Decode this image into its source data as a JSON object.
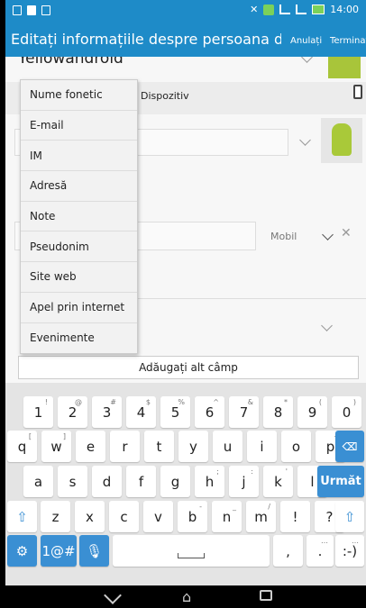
{
  "status_bar": {
    "time": "14:00"
  },
  "action_bar": {
    "title": "Editați informațiile despre persoana din...",
    "cancel_label": "Anulați",
    "done_label": "Terminat"
  },
  "form": {
    "name_value": "Yellowandroid",
    "device_label": "Dispozitiv",
    "phone_type": "Mobil",
    "add_field_label": "Adăugați alt câmp"
  },
  "menu": {
    "items": [
      "Nume fonetic",
      "E-mail",
      "IM",
      "Adresă",
      "Note",
      "Pseudonim",
      "Site web",
      "Apel prin internet",
      "Evenimente"
    ]
  },
  "keyboard": {
    "row1": [
      [
        "1",
        "!"
      ],
      [
        "2",
        "@"
      ],
      [
        "3",
        "#"
      ],
      [
        "4",
        "$"
      ],
      [
        "5",
        "%"
      ],
      [
        "6",
        "^"
      ],
      [
        "7",
        "&"
      ],
      [
        "8",
        "*"
      ],
      [
        "9",
        "("
      ],
      [
        "0",
        ")"
      ]
    ],
    "row2": [
      [
        "q",
        "["
      ],
      [
        "w",
        "]"
      ],
      [
        "e",
        ""
      ],
      [
        "r",
        ""
      ],
      [
        "t",
        ""
      ],
      [
        "y",
        ""
      ],
      [
        "u",
        ""
      ],
      [
        "i",
        ""
      ],
      [
        "o",
        ""
      ],
      [
        "p",
        "+"
      ]
    ],
    "row3": [
      [
        "a",
        ""
      ],
      [
        "s",
        ""
      ],
      [
        "d",
        ""
      ],
      [
        "f",
        ""
      ],
      [
        "g",
        ""
      ],
      [
        "h",
        ";"
      ],
      [
        "j",
        ":"
      ],
      [
        "k",
        "'"
      ],
      [
        "l",
        "\""
      ]
    ],
    "row4": [
      [
        "z",
        ""
      ],
      [
        "x",
        ""
      ],
      [
        "c",
        ""
      ],
      [
        "v",
        ""
      ],
      [
        "b",
        "-"
      ],
      [
        "n",
        "_"
      ],
      [
        "m",
        "/"
      ],
      [
        "!",
        ""
      ],
      [
        "?",
        ""
      ]
    ],
    "next_label": "Următ",
    "symbols_label": "1@#",
    "comma_label": ",",
    "period_label": ".",
    "smiley_label": ":-)"
  }
}
